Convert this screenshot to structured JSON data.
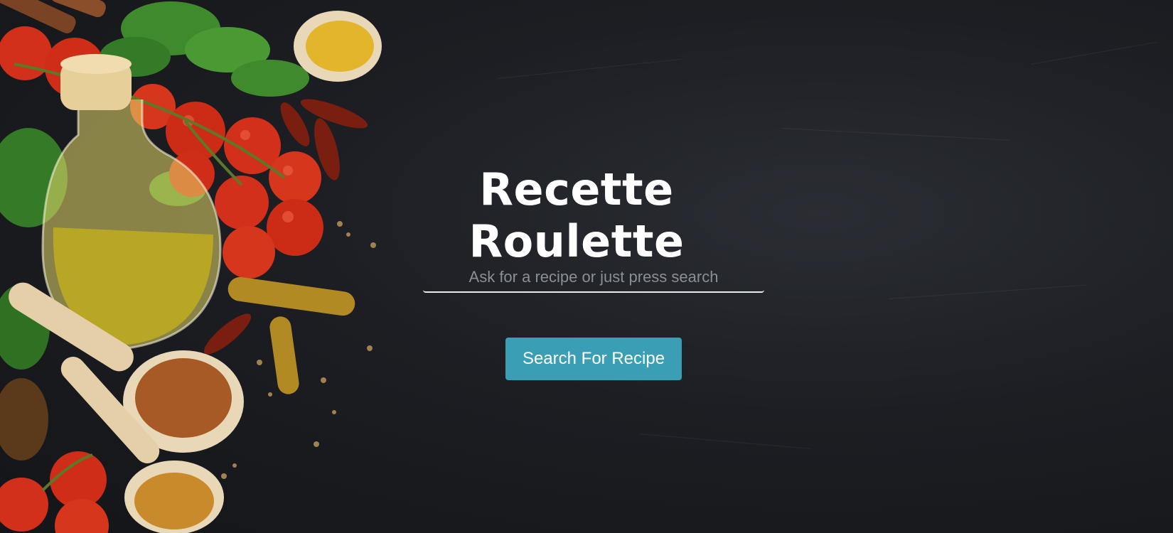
{
  "hero": {
    "title": "Recette Roulette",
    "search_placeholder": "Ask for a recipe or just press search",
    "search_value": "",
    "button_label": "Search For Recipe"
  },
  "colors": {
    "background": "#1c1e23",
    "button": "#3a9fb5",
    "title_text": "#ffffff",
    "placeholder": "#8a8f96"
  },
  "background_image": {
    "icon": "food-ingredients-illustration"
  }
}
